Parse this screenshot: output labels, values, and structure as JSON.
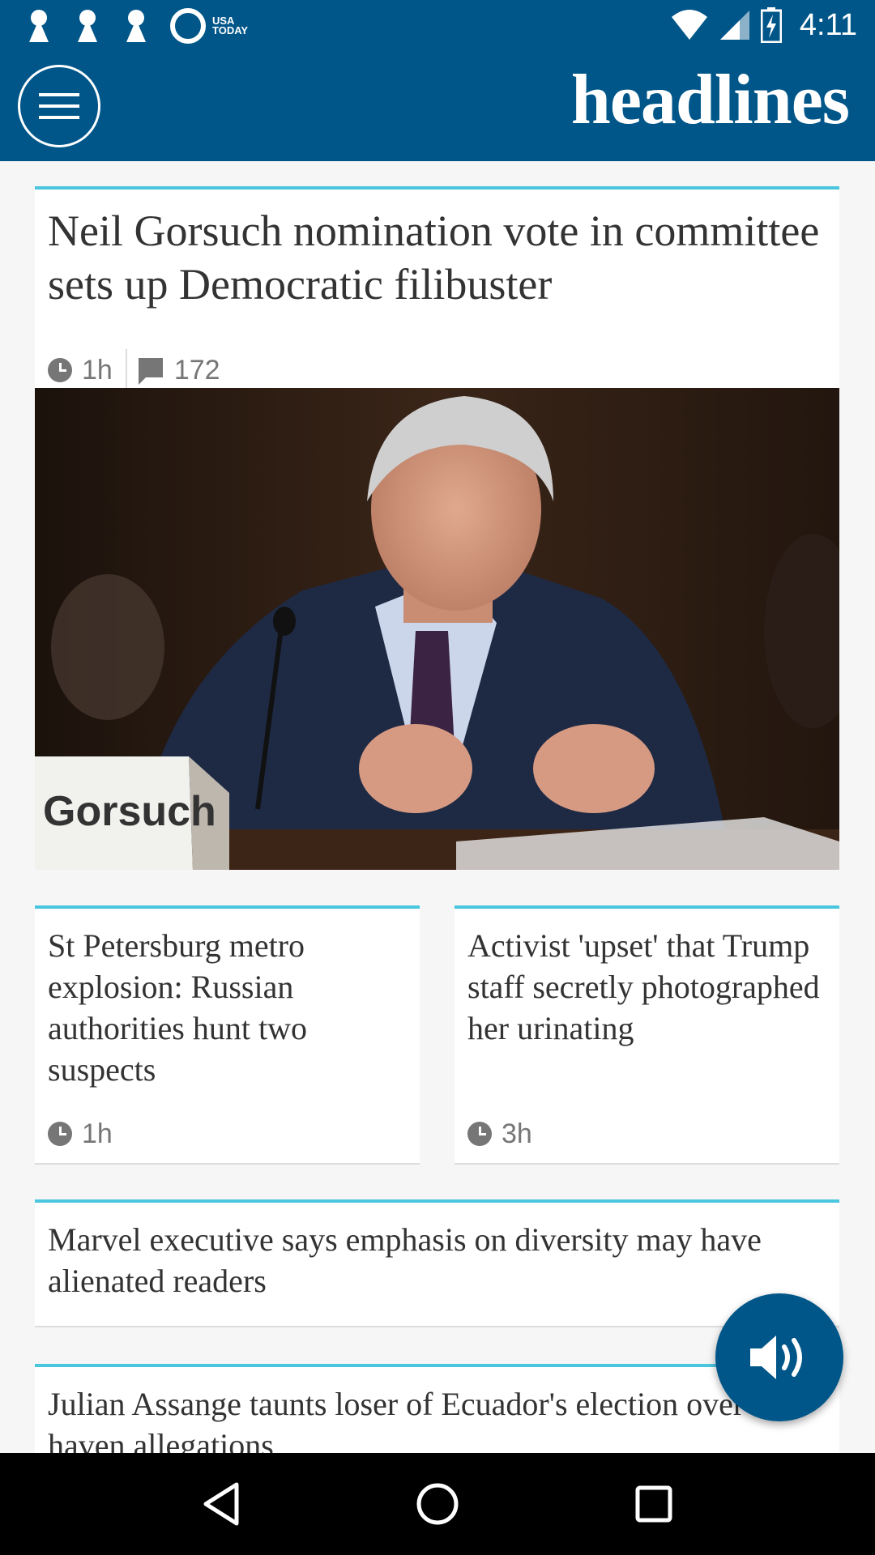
{
  "status_bar": {
    "notification_icons": [
      "keyhole-icon",
      "keyhole-icon",
      "keyhole-icon",
      "usa-today-icon"
    ],
    "usa_today_label_line1": "USA",
    "usa_today_label_line2": "TODAY",
    "time": "4:11",
    "icons": [
      "wifi-icon",
      "cell-signal-icon",
      "battery-charging-icon"
    ]
  },
  "app_bar": {
    "title": "headlines",
    "menu_icon": "hamburger-menu-icon"
  },
  "articles": {
    "main": {
      "headline": "Neil Gorsuch nomination vote in committee sets up Democratic filibuster",
      "age": "1h",
      "comments": "172",
      "image_caption_text": "Gorsuch"
    },
    "left": {
      "headline": "St Petersburg metro explosion: Russian authorities hunt two suspects",
      "age": "1h"
    },
    "right": {
      "headline": "Activist 'upset' that Trump staff secretly photographed her urinating",
      "age": "3h"
    },
    "wide": {
      "headline": "Marvel executive says emphasis on diversity may have alienated readers"
    },
    "bottom": {
      "headline": "Julian Assange taunts loser of Ecuador's election over tax haven allegations"
    }
  },
  "fab": {
    "icon": "speaker-icon"
  },
  "nav_bar": {
    "icons": [
      "back-icon",
      "home-icon",
      "recents-icon"
    ]
  },
  "colors": {
    "brand_blue": "#005689",
    "accent_blue": "#4bc6df",
    "text": "#333333",
    "meta": "#767676"
  }
}
